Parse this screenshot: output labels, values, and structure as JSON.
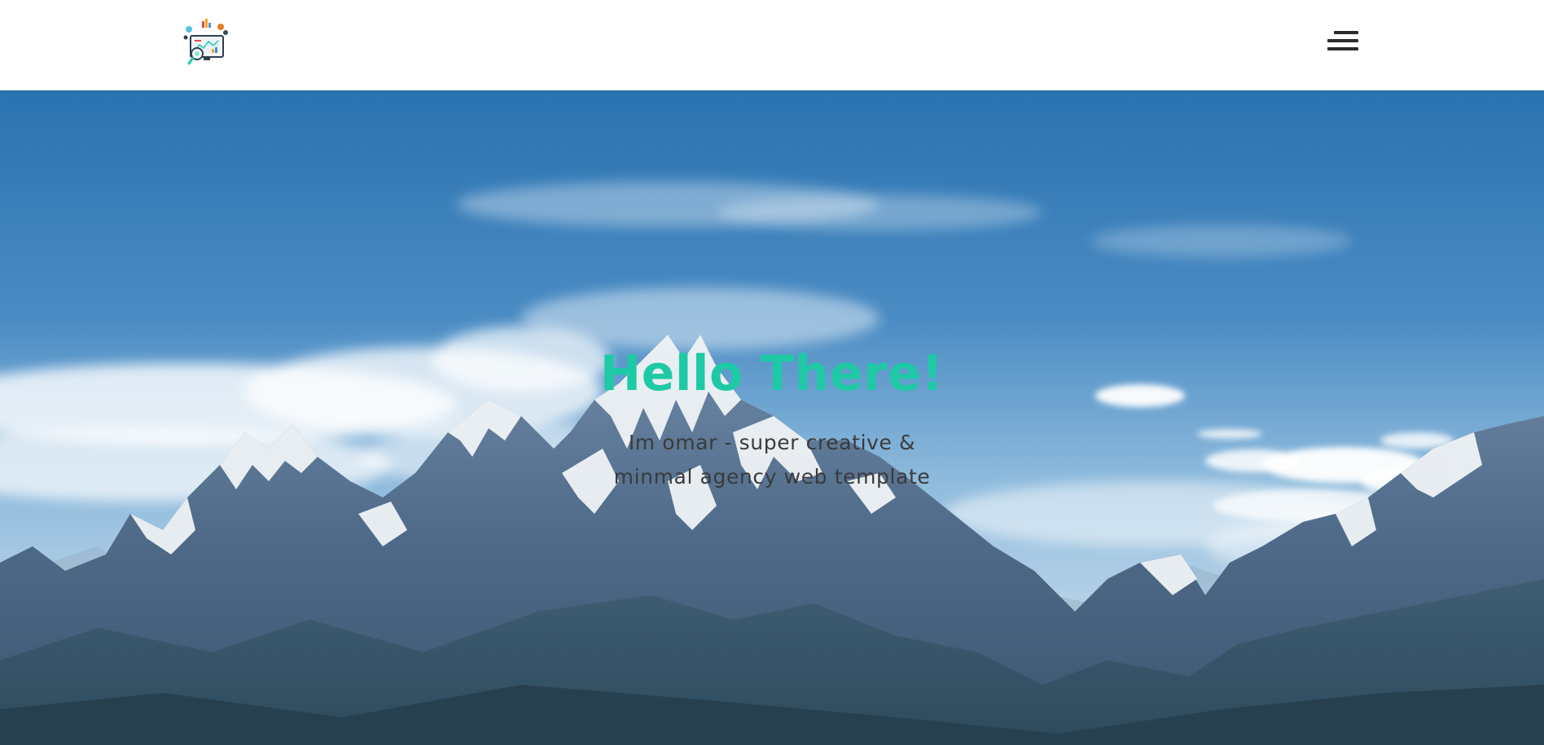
{
  "header": {
    "logo_name": "analytics-logo",
    "menu_icon": "hamburger-menu-icon"
  },
  "hero": {
    "title": "Hello There!",
    "subtitle_line1": "Im omar - super creative &",
    "subtitle_line2": "minmal agency web template",
    "background": "mountain-sky-photo"
  },
  "colors": {
    "accent": "#1fc9a6",
    "text_dark": "#3b3b3b",
    "sky_top": "#2a74b2",
    "sky_mid": "#5d9ccd",
    "menu_icon": "#2b2b2b"
  }
}
